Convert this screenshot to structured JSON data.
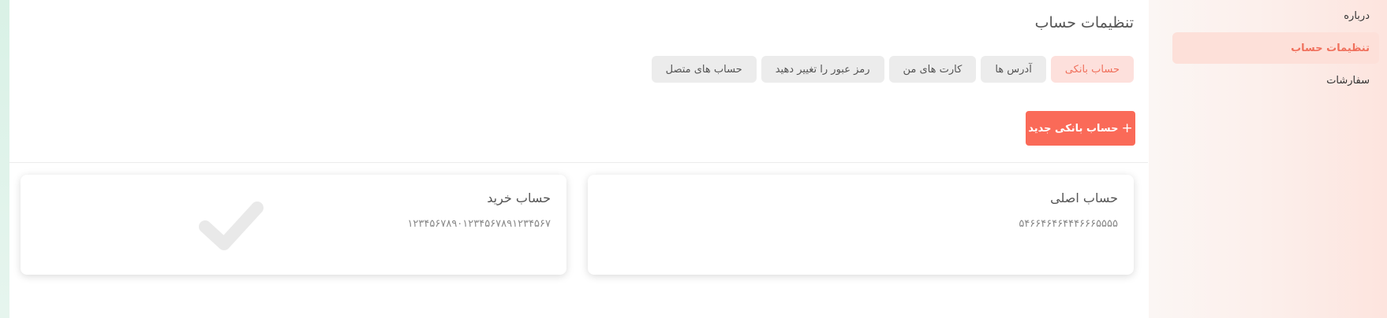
{
  "sidebar": {
    "items": [
      {
        "label": "درباره",
        "active": false
      },
      {
        "label": "تنظیمات حساب",
        "active": true
      },
      {
        "label": "سفارشات",
        "active": false
      }
    ]
  },
  "main": {
    "title": "تنظیمات حساب",
    "tabs": [
      {
        "label": "حساب بانکی",
        "active": true
      },
      {
        "label": "آدرس ها",
        "active": false
      },
      {
        "label": "کارت های من",
        "active": false
      },
      {
        "label": "رمز عبور را تغییر دهید",
        "active": false
      },
      {
        "label": "حساب های متصل",
        "active": false
      }
    ],
    "new_button": {
      "plus": "+",
      "label": "حساب بانکی جدید"
    },
    "cards": [
      {
        "title": "حساب اصلی",
        "number": "۵۴۶۶۴۶۴۶۴۴۴۶۶۶۵۵۵۵",
        "selected": false
      },
      {
        "title": "حساب خرید",
        "number": "۱۲۳۴۵۶۷۸۹۰۱۲۳۴۵۶۷۸۹۱۲۳۴۵۶۷",
        "selected": true,
        "icon": "check-icon"
      }
    ]
  },
  "colors": {
    "accent": "#fa6a58",
    "accent_text": "#f0705c",
    "accent_soft": "#fde0dc",
    "tab_bg": "#ececec"
  }
}
